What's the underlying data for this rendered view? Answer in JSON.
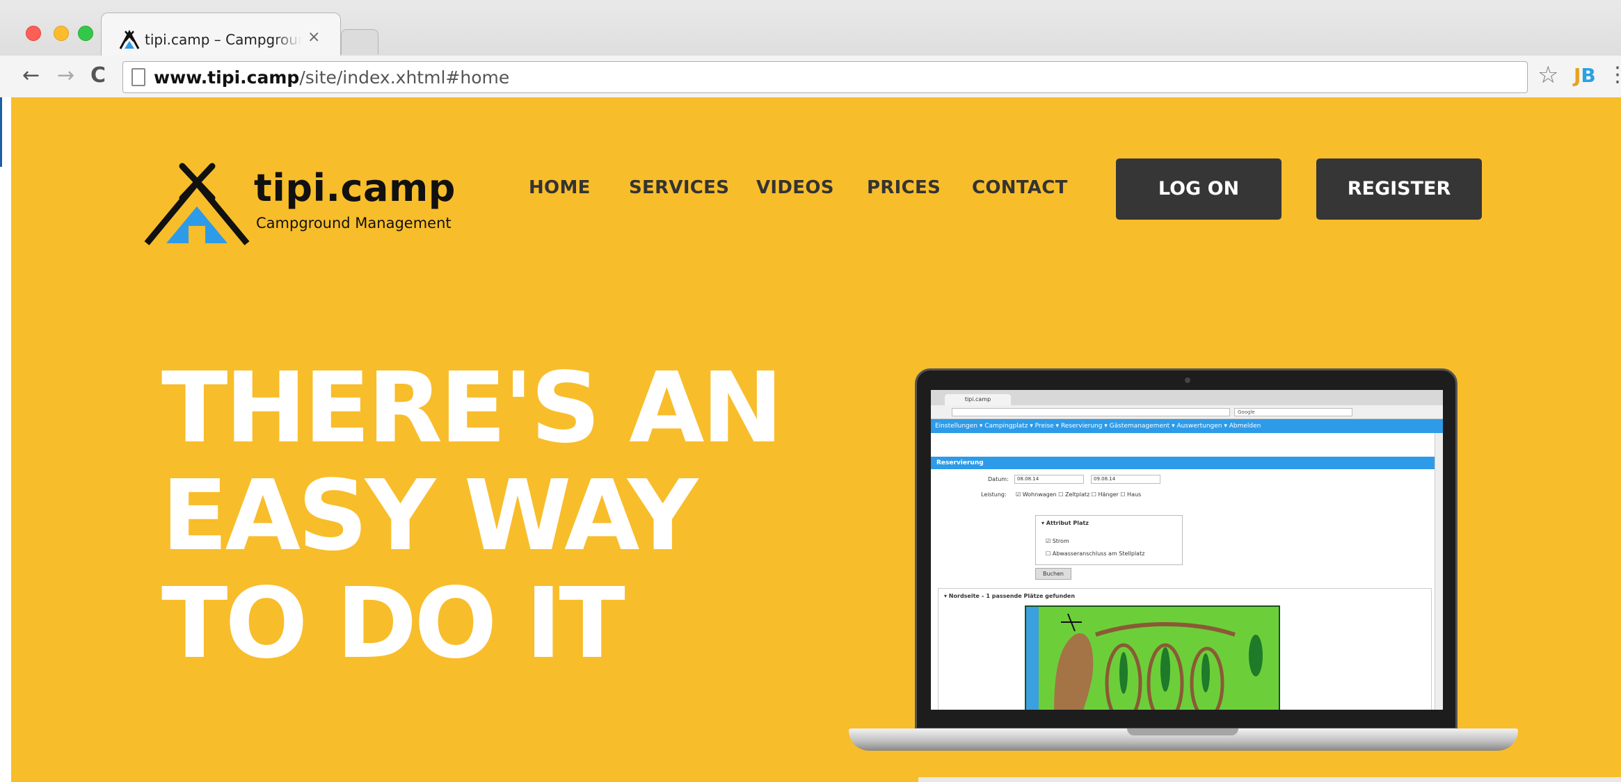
{
  "browser": {
    "tab_title": "tipi.camp – Campground M",
    "tab_close": "×",
    "url_host": "www.tipi.camp",
    "url_path": "/site/index.xhtml#home",
    "extension_label_j": "J",
    "extension_label_b": "B",
    "back_glyph": "←",
    "forward_glyph": "→",
    "reload_glyph": "C",
    "star_glyph": "☆",
    "menu_glyph": "⋮",
    "corner_glyph": "↑"
  },
  "brand": {
    "name": "tipi.camp",
    "tagline": "Campground Management",
    "colors": {
      "background": "#f8bd2a",
      "dark": "#363636",
      "tent_blue": "#2e9be8"
    }
  },
  "nav": {
    "items": [
      {
        "label": "HOME"
      },
      {
        "label": "SERVICES"
      },
      {
        "label": "VIDEOS"
      },
      {
        "label": "PRICES"
      },
      {
        "label": "CONTACT"
      }
    ],
    "logon_label": "LOG ON",
    "register_label": "REGISTER"
  },
  "hero": {
    "line1": "THERE'S AN",
    "line2": "EASY WAY",
    "line3": "TO DO IT"
  },
  "laptop_screen": {
    "tab": "tipi.camp",
    "menu": "Einstellungen ▾  Campingplatz ▾  Preise ▾  Reservierung ▾  Gästemanagement ▾  Auswertungen ▾  Abmelden",
    "section_title": "Reservierung",
    "datum_label": "Datum:",
    "datum_from": "08.08.14",
    "datum_to": "09.08.14",
    "leistung_label": "Leistung:",
    "leistung_options": "☑ Wohnwagen ☐ Zeltplatz ☐ Hänger ☐ Haus",
    "attribut_title": "▾  Attribut Platz",
    "attr_1": "☑ Strom",
    "attr_2": "☐ Abwasseranschluss am Stellplatz",
    "search_button": "Buchen",
    "result_title": "▾  Nordseite – 1 passende Plätze gefunden",
    "search_placeholder": "Google"
  }
}
